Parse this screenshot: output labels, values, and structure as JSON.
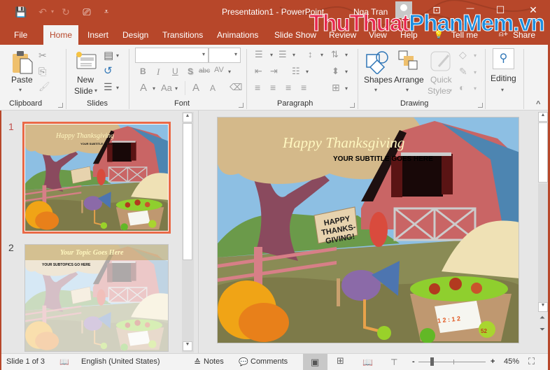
{
  "titlebar": {
    "title": "Presentation1  -  PowerPoint",
    "user": "Nga Tran",
    "qat": {
      "save_icon": "💾",
      "undo_icon": "↶",
      "undo_caret": "▾",
      "redo_icon": "↻",
      "present_icon": "⎚",
      "customize_icon": "⩡"
    },
    "window": {
      "ribbon_display_icon": "⊡",
      "minimize_icon": "—",
      "maximize_icon": "☐",
      "close_icon": "✕"
    }
  },
  "watermark": {
    "part1": "ThuThuat",
    "part2": "PhanMem.vn"
  },
  "tabs": [
    {
      "label": "File"
    },
    {
      "label": "Home"
    },
    {
      "label": "Insert"
    },
    {
      "label": "Design"
    },
    {
      "label": "Transitions"
    },
    {
      "label": "Animations"
    },
    {
      "label": "Slide Show"
    },
    {
      "label": "Review"
    },
    {
      "label": "View"
    },
    {
      "label": "Help"
    },
    {
      "label": "Tell me"
    },
    {
      "label": "Share"
    }
  ],
  "tell_me_icon": "💡",
  "share_icon": "⍝+",
  "ribbon": {
    "clipboard": {
      "group": "Clipboard",
      "paste": "Paste",
      "cut_icon": "✂",
      "copy_icon": "⎘",
      "painter_icon": "🖌"
    },
    "slides": {
      "group": "Slides",
      "new_slide_line1": "New",
      "new_slide_line2": "Slide",
      "layout_icon": "▤",
      "reset_icon": "↺",
      "section_icon": "☰"
    },
    "font": {
      "group": "Font",
      "font_name": "",
      "font_size": "",
      "bold": "B",
      "italic": "I",
      "underline": "U",
      "shadow": "S",
      "strike": "abc",
      "spacing": "AV",
      "color": "A",
      "case": "Aa",
      "grow": "A",
      "shrink": "A",
      "clear_icon": "⌫"
    },
    "paragraph": {
      "group": "Paragraph",
      "bullets_icon": "☰",
      "numbering_icon": "☰",
      "line_spacing_icon": "↕",
      "direction_icon": "⇅",
      "outdent_icon": "⇤",
      "indent_icon": "⇥",
      "columns_icon": "☷",
      "align_text_icon": "⬍",
      "left_icon": "≡",
      "center_icon": "≡",
      "right_icon": "≡",
      "justify_icon": "≡",
      "smartart_icon": "⊞"
    },
    "drawing": {
      "group": "Drawing",
      "shapes": "Shapes",
      "arrange": "Arrange",
      "quick_line1": "Quick",
      "quick_line2": "Styles",
      "fill_icon": "◇",
      "outline_icon": "✎",
      "effects_icon": "◐"
    },
    "editing": {
      "group": "",
      "label": "Editing",
      "find_icon": "⚲"
    },
    "collapse_icon": "^"
  },
  "thumbnails": [
    {
      "number": "1",
      "title": "Happy Thanksgiving",
      "subtitle": "YOUR SUBTITLE GOES HERE",
      "selected": true
    },
    {
      "number": "2",
      "title": "Your Topic Goes Here",
      "subtitle": "YOUR SUBTOPICS GO HERE",
      "selected": false
    }
  ],
  "slide": {
    "title": "Happy Thanksgiving",
    "subtitle": "YOUR SUBTITLE GOES HERE",
    "sign_line1": "HAPPY",
    "sign_line2": "THANKS-",
    "sign_line3": "GIVING!",
    "basket_tag": "1 2 : 1 2",
    "apple_tag": "52"
  },
  "scroll": {
    "up_icon": "▲",
    "down_icon": "▼",
    "prev_slide_icon": "⏶",
    "next_slide_icon": "⏷"
  },
  "status": {
    "slide_info": "Slide 1 of 3",
    "spellcheck_icon": "📖",
    "language": "English (United States)",
    "notes_icon": "≙",
    "notes": "Notes",
    "comments_icon": "💬",
    "comments": "Comments",
    "view_normal_icon": "▣",
    "view_sorter_icon": "⊞",
    "view_reading_icon": "📖",
    "view_slideshow_icon": "⊤",
    "zoom_minus": "-",
    "zoom_plus": "+",
    "zoom_value": 45,
    "zoom_label": "45%",
    "fit_icon": "⛶"
  },
  "colors": {
    "accent": "#b7472a",
    "ribbon_bg": "#f3f3f3",
    "workspace": "#e6e6e6",
    "selected_border": "#ea6a47"
  }
}
